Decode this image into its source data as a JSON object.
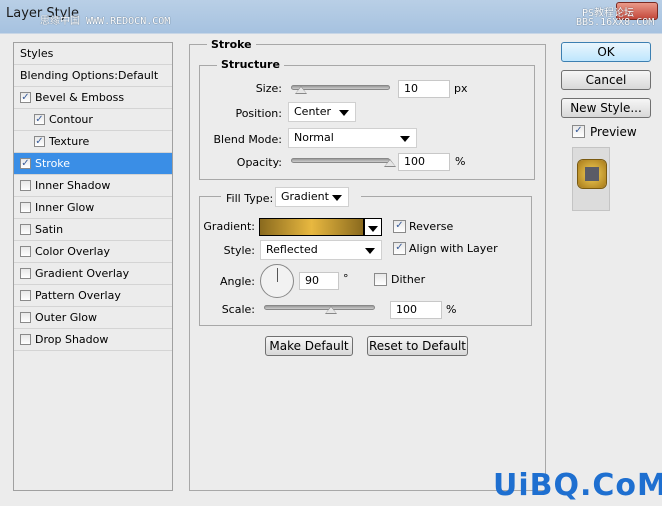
{
  "window": {
    "title": "Layer Style",
    "watermark_left": "思缘中国 WWW.REDOCN.COM",
    "watermark_right_1": "PS教程论坛",
    "watermark_right_2": "BBS.16XX8.COM",
    "watermark_bottom": "UiBQ.CoM"
  },
  "sidebar": {
    "items": [
      {
        "label": "Styles",
        "type": "header"
      },
      {
        "label": "Blending Options:Default",
        "type": "header"
      },
      {
        "label": "Bevel & Emboss",
        "checked": true
      },
      {
        "label": "Contour",
        "checked": true,
        "sub": true
      },
      {
        "label": "Texture",
        "checked": true,
        "sub": true
      },
      {
        "label": "Stroke",
        "checked": true,
        "selected": true
      },
      {
        "label": "Inner Shadow",
        "checked": false
      },
      {
        "label": "Inner Glow",
        "checked": false
      },
      {
        "label": "Satin",
        "checked": false
      },
      {
        "label": "Color Overlay",
        "checked": false
      },
      {
        "label": "Gradient Overlay",
        "checked": false
      },
      {
        "label": "Pattern Overlay",
        "checked": false
      },
      {
        "label": "Outer Glow",
        "checked": false
      },
      {
        "label": "Drop Shadow",
        "checked": false
      }
    ]
  },
  "stroke": {
    "title": "Stroke",
    "structure": {
      "title": "Structure",
      "size_label": "Size:",
      "size": "10",
      "size_unit": "px",
      "size_slider_pct": 10,
      "position_label": "Position:",
      "position": "Center",
      "blend_label": "Blend Mode:",
      "blend": "Normal",
      "opacity_label": "Opacity:",
      "opacity": "100",
      "opacity_unit": "%",
      "opacity_slider_pct": 100
    },
    "fill": {
      "filltype_label": "Fill Type:",
      "filltype": "Gradient",
      "gradient_label": "Gradient:",
      "gradient_colors": [
        "#8a6a1e",
        "#e8b840",
        "#8a6a1e"
      ],
      "reverse_label": "Reverse",
      "reverse": true,
      "style_label": "Style:",
      "style": "Reflected",
      "align_label": "Align with Layer",
      "align": true,
      "angle_label": "Angle:",
      "angle": "90",
      "angle_unit": "°",
      "dither_label": "Dither",
      "dither": false,
      "scale_label": "Scale:",
      "scale": "100",
      "scale_unit": "%",
      "scale_slider_pct": 50
    },
    "make_default": "Make Default",
    "reset_default": "Reset to Default"
  },
  "actions": {
    "ok": "OK",
    "cancel": "Cancel",
    "new_style": "New Style...",
    "preview_label": "Preview",
    "preview": true
  }
}
